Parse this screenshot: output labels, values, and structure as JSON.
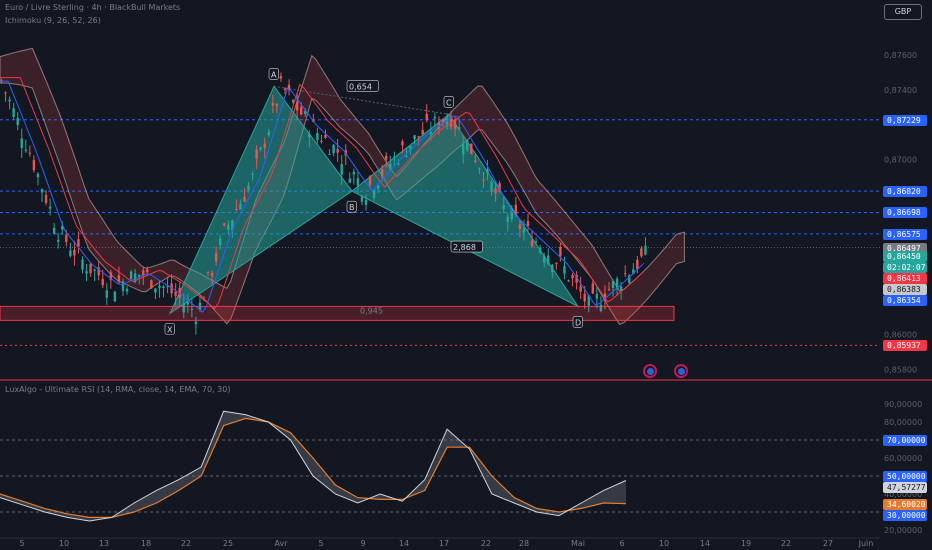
{
  "header": {
    "title": "Euro / Livre Sterling · 4h · BlackBull Markets",
    "indicator1": "Ichimoku (9, 26, 52, 26)",
    "indicator2": "LuxAlgo - Ultimate RSI (14, RMA, close, 14, EMA, 70, 30)",
    "currency": "GBP"
  },
  "colors": {
    "background": "#131722",
    "up": "#26a69a",
    "down": "#ef5350",
    "harmonic": "#26a69a",
    "blue_line": "#2962ff",
    "red_line": "#f23645"
  },
  "price_axis": {
    "ticks": [
      "0,87600",
      "0,87400",
      "0,87000",
      "0,86000",
      "0,85800"
    ],
    "labels": [
      {
        "text": "0,87229",
        "price": 0.87229,
        "color": "#2962ff"
      },
      {
        "text": "0,86820",
        "price": 0.8682,
        "color": "#2962ff"
      },
      {
        "text": "0,86698",
        "price": 0.86698,
        "color": "#2962ff"
      },
      {
        "text": "0,86575",
        "price": 0.86575,
        "color": "#2962ff"
      },
      {
        "text": "0,86497",
        "price": 0.86497,
        "color": "#787b86"
      },
      {
        "text": "0,86450",
        "price": 0.8645,
        "color": "#26a69a"
      },
      {
        "text": "02:02:07",
        "price": 0.86412,
        "color": "#26a69a"
      },
      {
        "text": "0,86413",
        "price": 0.86413,
        "color": "#f23645"
      },
      {
        "text": "0,86383",
        "price": 0.86383,
        "color": "#c7c8cb"
      },
      {
        "text": "0,86354",
        "price": 0.86354,
        "color": "#2962ff"
      },
      {
        "text": "0,85937",
        "price": 0.85937,
        "color": "#f23645"
      }
    ]
  },
  "rsi_axis": {
    "ticks": [
      "90,00000",
      "80,00000",
      "60,00000",
      "40,00000",
      "20,00000"
    ],
    "labels": [
      {
        "text": "70,00000",
        "value": 70,
        "color": "#2962ff"
      },
      {
        "text": "50,00000",
        "value": 50,
        "color": "#2962ff"
      },
      {
        "text": "47,57277",
        "value": 47.57277,
        "color": "#d1d4dc"
      },
      {
        "text": "34,60020",
        "value": 34.6002,
        "color": "#e67c2b"
      },
      {
        "text": "30,00000",
        "value": 30,
        "color": "#2962ff"
      }
    ]
  },
  "time_axis": [
    "5",
    "10",
    "13",
    "18",
    "22",
    "25",
    "Avr",
    "5",
    "9",
    "14",
    "17",
    "22",
    "28",
    "Mai",
    "6",
    "10",
    "14",
    "19",
    "22",
    "27",
    "Juin"
  ],
  "chart_data": {
    "type": "line",
    "title": "Euro / Livre Sterling · 4h · BlackBull Markets",
    "ylim": [
      0.8575,
      0.878
    ],
    "harmonic_pattern": {
      "points": [
        {
          "label": "X",
          "price": 0.8612
        },
        {
          "label": "A",
          "price": 0.8742
        },
        {
          "label": "B",
          "price": 0.8682
        },
        {
          "label": "C",
          "price": 0.8726
        },
        {
          "label": "D",
          "price": 0.8616
        }
      ],
      "ratios": [
        "0,654",
        "2,868",
        "0,945"
      ]
    },
    "support_zone": {
      "low": 0.8608,
      "high": 0.8616
    },
    "price_path": [
      0.8745,
      0.8705,
      0.866,
      0.864,
      0.8628,
      0.8635,
      0.8625,
      0.8612,
      0.866,
      0.869,
      0.8742,
      0.872,
      0.8705,
      0.8682,
      0.87,
      0.8715,
      0.8726,
      0.87,
      0.867,
      0.8655,
      0.864,
      0.8616,
      0.863,
      0.8645
    ],
    "rsi": {
      "ylim": [
        20,
        95
      ],
      "values": [
        38,
        34,
        30,
        27,
        25,
        27,
        35,
        42,
        48,
        55,
        86,
        84,
        80,
        70,
        50,
        40,
        35,
        40,
        36,
        48,
        76,
        65,
        40,
        35,
        30,
        28,
        35,
        42,
        47.5
      ],
      "signal": [
        40,
        36,
        32,
        29,
        27,
        27,
        30,
        35,
        42,
        50,
        78,
        82,
        80,
        74,
        60,
        45,
        38,
        37,
        37,
        42,
        66,
        66,
        50,
        38,
        32,
        30,
        32,
        35,
        34.6
      ]
    }
  }
}
